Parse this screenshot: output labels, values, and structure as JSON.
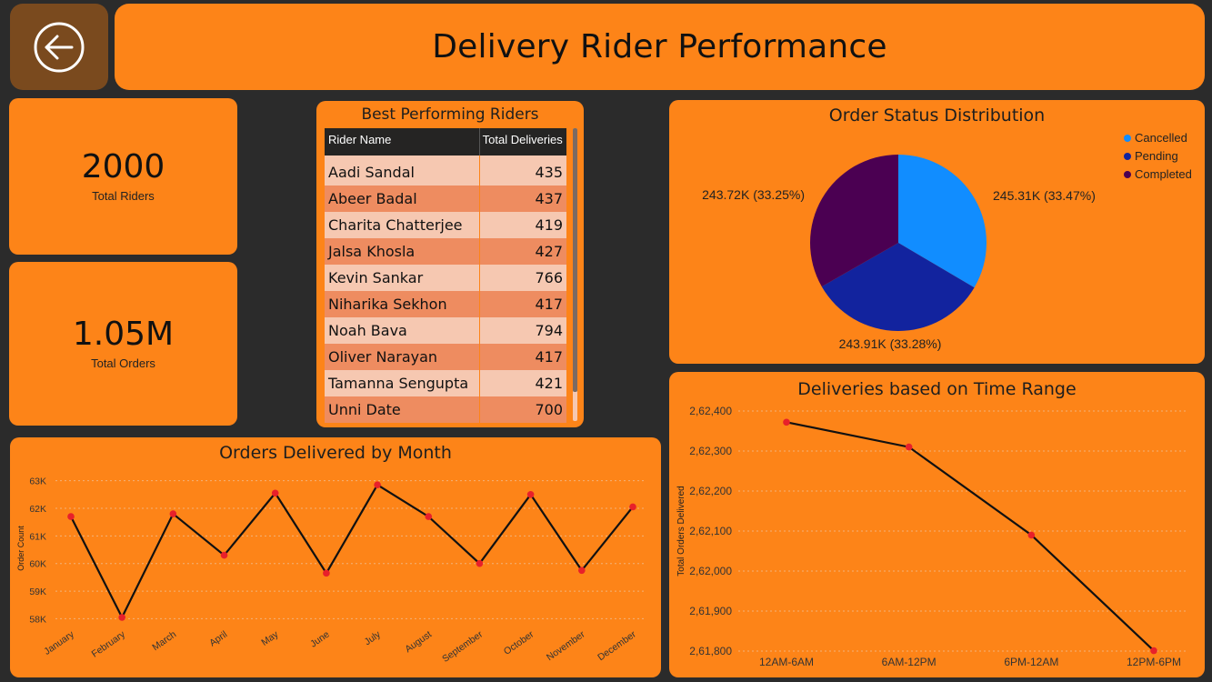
{
  "header": {
    "title": "Delivery Rider Performance",
    "back_icon": "arrow-left-circle-icon"
  },
  "kpis": [
    {
      "value": "2000",
      "label": "Total Riders"
    },
    {
      "value": "1.05M",
      "label": "Total Orders"
    }
  ],
  "riders": {
    "title": "Best Performing Riders",
    "columns": [
      "Rider Name",
      "Total Deliveries"
    ],
    "rows": [
      [
        "Aadi Sandal",
        "435"
      ],
      [
        "Abeer Badal",
        "437"
      ],
      [
        "Charita Chatterjee",
        "419"
      ],
      [
        "Jalsa Khosla",
        "427"
      ],
      [
        "Kevin Sankar",
        "766"
      ],
      [
        "Niharika Sekhon",
        "417"
      ],
      [
        "Noah Bava",
        "794"
      ],
      [
        "Oliver Narayan",
        "417"
      ],
      [
        "Tamanna Sengupta",
        "421"
      ],
      [
        "Unni Date",
        "700"
      ]
    ]
  },
  "colors": {
    "card": "#fd8418",
    "background": "#2b2b2b",
    "cancelled": "#118dff",
    "pending": "#12239e",
    "completed": "#4b0052",
    "line": "#111111",
    "marker": "#e8202a"
  },
  "chart_data": [
    {
      "type": "pie",
      "title": "Order Status Distribution",
      "legend_position": "top-right",
      "categories": [
        "Cancelled",
        "Pending",
        "Completed"
      ],
      "values": [
        245310,
        243910,
        243720
      ],
      "labels": [
        "245.31K (33.47%)",
        "243.91K (33.28%)",
        "243.72K (33.25%)"
      ]
    },
    {
      "type": "line",
      "title": "Orders Delivered by Month",
      "xlabel": "",
      "ylabel": "Order Count",
      "categories": [
        "January",
        "February",
        "March",
        "April",
        "May",
        "June",
        "July",
        "August",
        "September",
        "October",
        "November",
        "December"
      ],
      "values": [
        61700,
        58050,
        61800,
        60300,
        62550,
        59650,
        62850,
        61700,
        60000,
        62500,
        59750,
        62050
      ],
      "ylim": [
        57800,
        63300
      ],
      "yticks": [
        58000,
        59000,
        60000,
        61000,
        62000,
        63000
      ],
      "ytick_labels": [
        "58K",
        "59K",
        "60K",
        "61K",
        "62K",
        "63K"
      ],
      "grid": true
    },
    {
      "type": "line",
      "title": "Deliveries based on Time Range",
      "xlabel": "",
      "ylabel": "Total Orders Delivered",
      "categories": [
        "12AM-6AM",
        "6AM-12PM",
        "6PM-12AM",
        "12PM-6PM"
      ],
      "values": [
        262372,
        262310,
        262090,
        261801
      ],
      "ylim": [
        261800,
        262400
      ],
      "yticks": [
        261800,
        261900,
        262000,
        262100,
        262200,
        262300,
        262400
      ],
      "ytick_labels": [
        "2,61,800",
        "2,61,900",
        "2,62,000",
        "2,62,100",
        "2,62,200",
        "2,62,300",
        "2,62,400"
      ],
      "grid": true
    }
  ]
}
